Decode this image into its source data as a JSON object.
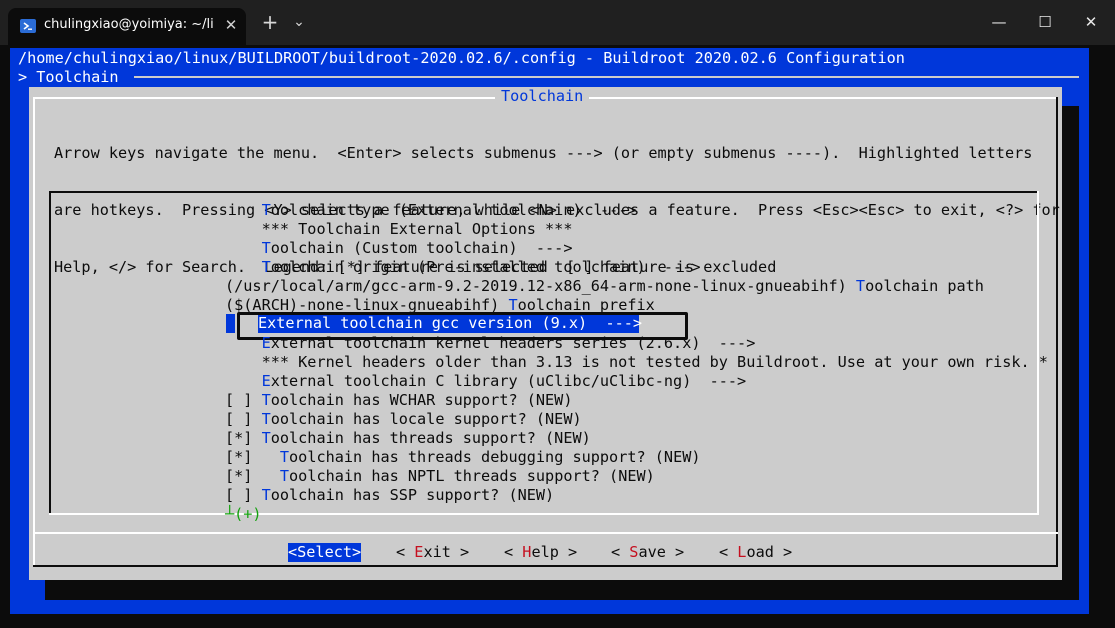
{
  "window": {
    "tab_title": "chulingxiao@yoimiya: ~/linux",
    "tab_icon": "powershell-icon",
    "new_tab_label": "+",
    "dropdown_label": "⌄",
    "minimize_label": "—",
    "maximize_label": "☐",
    "close_label": "✕",
    "tab_close_label": "✕"
  },
  "header": {
    "path": "/home/chulingxiao/linux/BUILDROOT/buildroot-2020.02.6/.config - Buildroot 2020.02.6 Configuration",
    "breadcrumb": "> Toolchain"
  },
  "dialog": {
    "title": "Toolchain",
    "help_lines": [
      "Arrow keys navigate the menu.  <Enter> selects submenus ---> (or empty submenus ----).  Highlighted letters",
      "are hotkeys.  Pressing <Y> selects a feature, while <N> excludes a feature.  Press <Esc><Esc> to exit, <?> for",
      "Help, </> for Search.  Legend: [*] feature is selected  [ ] feature is excluded"
    ]
  },
  "menu": {
    "items": [
      {
        "prefix": "    ",
        "hotkey": "T",
        "rest": "oolchain type (External toolchain)  --->"
      },
      {
        "prefix": "    ",
        "hotkey": "",
        "rest": "*** Toolchain External Options ***"
      },
      {
        "prefix": "    ",
        "hotkey": "T",
        "rest": "oolchain (Custom toolchain)  --->"
      },
      {
        "prefix": "    ",
        "hotkey": "T",
        "rest": "oolchain origin (Pre-installed toolchain)  --->"
      },
      {
        "prefix": "(/usr/local/arm/gcc-arm-9.2-2019.12-x86_64-arm-none-linux-gnueabihf) ",
        "hotkey": "T",
        "rest": "oolchain path"
      },
      {
        "prefix": "($(ARCH)-none-linux-gnueabihf) ",
        "hotkey": "T",
        "rest": "oolchain prefix"
      },
      {
        "prefix": "    ",
        "hotkey": "",
        "rest": "External toolchain gcc version (9.x)  --->"
      },
      {
        "prefix": "    ",
        "hotkey": "E",
        "rest": "xternal toolchain kernel headers series (2.6.x)  --->"
      },
      {
        "prefix": "    ",
        "hotkey": "",
        "rest": "*** Kernel headers older than 3.13 is not tested by Buildroot. Use at your own risk. *"
      },
      {
        "prefix": "    ",
        "hotkey": "E",
        "rest": "xternal toolchain C library (uClibc/uClibc-ng)  --->"
      },
      {
        "prefix": "[ ] ",
        "hotkey": "T",
        "rest": "oolchain has WCHAR support? (NEW)"
      },
      {
        "prefix": "[ ] ",
        "hotkey": "T",
        "rest": "oolchain has locale support? (NEW)"
      },
      {
        "prefix": "[*] ",
        "hotkey": "T",
        "rest": "oolchain has threads support? (NEW)"
      },
      {
        "prefix": "[*]   ",
        "hotkey": "T",
        "rest": "oolchain has threads debugging support? (NEW)"
      },
      {
        "prefix": "[*]   ",
        "hotkey": "T",
        "rest": "oolchain has NPTL threads support? (NEW)"
      },
      {
        "prefix": "[ ] ",
        "hotkey": "T",
        "rest": "oolchain has SSP support? (NEW)"
      }
    ],
    "selected_index": 6,
    "more_indicator": "┴(+)"
  },
  "buttons": {
    "select": "<Select>",
    "exit": {
      "left": "< ",
      "hotkey": "E",
      "rest": "xit",
      "right": " >"
    },
    "help": {
      "left": "< ",
      "hotkey": "H",
      "rest": "elp",
      "right": " >"
    },
    "save": {
      "left": "< ",
      "hotkey": "S",
      "rest": "ave",
      "right": " >"
    },
    "load": {
      "left": "< ",
      "hotkey": "L",
      "rest": "oad",
      "right": " >"
    }
  },
  "colors": {
    "blue": "#0037da",
    "dialog_gray": "#cccccc",
    "hotkey_red": "#c50f1f",
    "more_green": "#13a10e"
  }
}
